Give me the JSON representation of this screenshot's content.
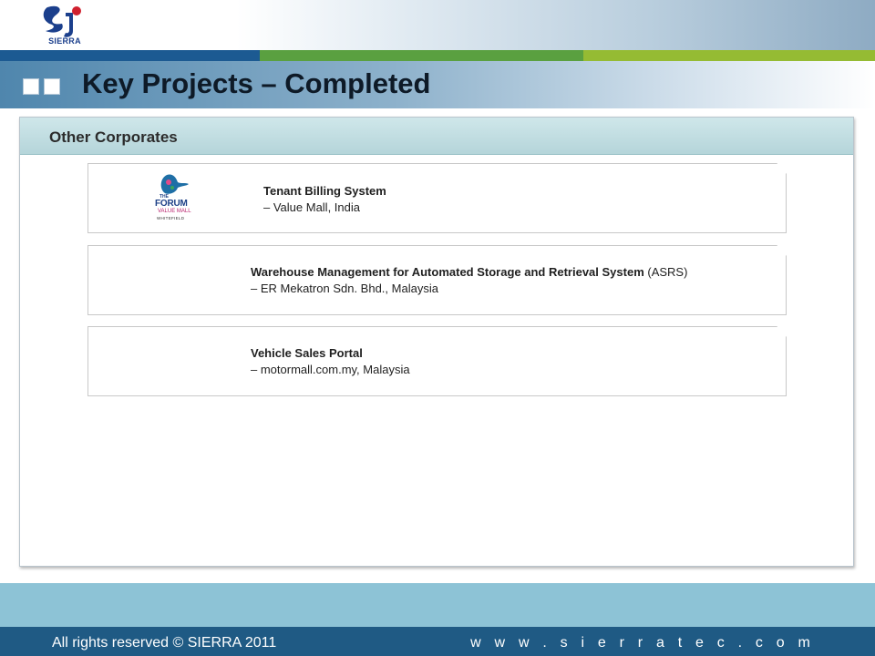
{
  "header": {
    "logo_text": "SIERRA",
    "title": "Key Projects – Completed"
  },
  "section": {
    "title": "Other Corporates",
    "projects": [
      {
        "logo_lines": [
          "THE",
          "FORUM",
          "VALUE MALL",
          "WHITEFIELD"
        ],
        "name": "Tenant Billing System",
        "detail": "–  Value Mall, India"
      },
      {
        "name": "Warehouse Management for Automated Storage and  Retrieval System",
        "name_suffix": " (ASRS)",
        "detail": "–  ER Mekatron Sdn. Bhd., Malaysia"
      },
      {
        "name": "Vehicle Sales Portal",
        "detail": "–  motormall.com.my, Malaysia"
      }
    ]
  },
  "footer": {
    "copyright": "All rights reserved © SIERRA  2011",
    "website": "w w w . s i e r r a t e c . c o m"
  },
  "colors": {
    "brand_blue": "#1c5a92",
    "brand_green": "#5aa040",
    "brand_lime": "#95bb33",
    "footer_dark": "#1f5a84",
    "footer_light": "#8dc3d6",
    "panel_header": "#b5d5da",
    "logo_red": "#d0202e"
  }
}
